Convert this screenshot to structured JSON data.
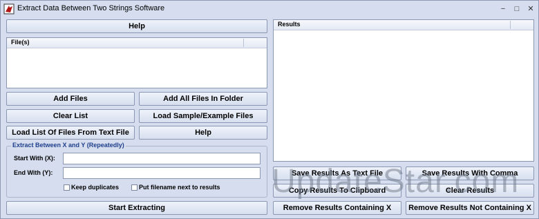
{
  "window": {
    "title": "Extract Data Between Two Strings Software",
    "minimize_glyph": "−",
    "maximize_glyph": "□",
    "close_glyph": "✕"
  },
  "left": {
    "help_top_label": "Help",
    "files_header": "File(s)",
    "add_files_label": "Add Files",
    "add_all_folder_label": "Add All Files In Folder",
    "clear_list_label": "Clear List",
    "load_sample_label": "Load Sample/Example Files",
    "load_list_label": "Load List Of Files From Text File",
    "help_label": "Help"
  },
  "extract": {
    "group_title": "Extract Between X and Y (Repeatedly)",
    "start_label": "Start With (X):",
    "start_value": "",
    "end_label": "End With (Y):",
    "end_value": "",
    "keep_duplicates_label": "Keep duplicates",
    "keep_duplicates_checked": false,
    "put_filename_label": "Put filename next to results",
    "put_filename_checked": false,
    "start_extracting_label": "Start Extracting"
  },
  "results": {
    "header": "Results",
    "save_text_label": "Save Results As Text File",
    "save_comma_label": "Save Results With Comma",
    "copy_label": "Copy Results To Clipboard",
    "clear_label": "Clear Results",
    "remove_containing_label": "Remove Results Containing X",
    "remove_not_containing_label": "Remove Results Not Containing X"
  },
  "watermark": "UpdateStar.com",
  "colors": {
    "window_bg": "#d5ddee",
    "button_border": "#8a97b2",
    "group_title": "#1e3f8c"
  }
}
